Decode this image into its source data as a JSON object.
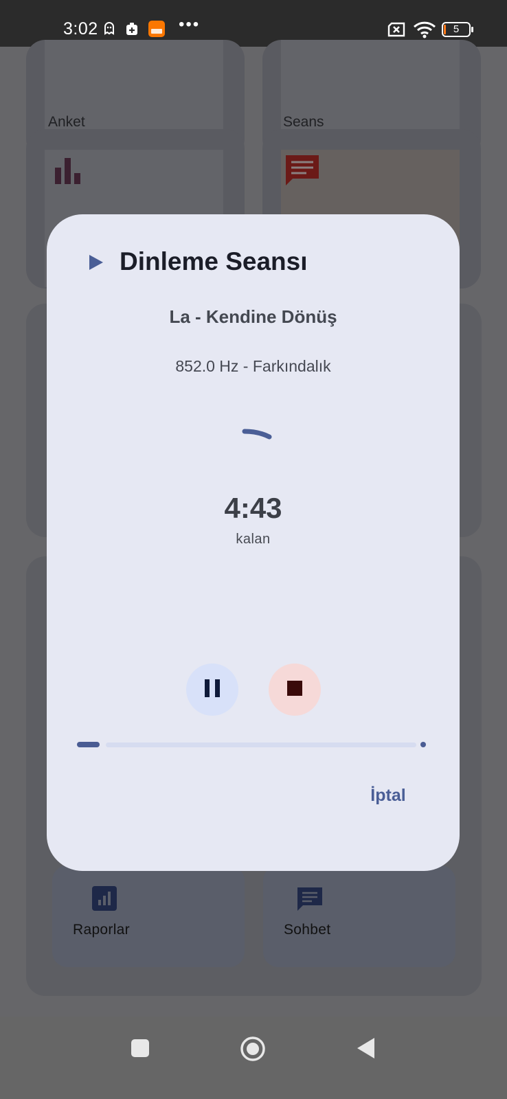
{
  "status_bar": {
    "time": "3:02",
    "battery_level": "5",
    "icons": [
      "ghost-icon",
      "medkit-icon",
      "temu-app-icon",
      "more-dots-icon",
      "no-sim-icon",
      "wifi-icon",
      "battery-icon"
    ]
  },
  "background": {
    "top_cards": [
      {
        "label": "Anket"
      },
      {
        "label": "Seans"
      }
    ],
    "tiles": [
      {
        "label": "Raporlar",
        "icon": "bar-chart-icon"
      },
      {
        "label": "Sohbet",
        "icon": "chat-icon"
      }
    ]
  },
  "dialog": {
    "title": "Dinleme Seansı",
    "title_icon": "play-icon",
    "track_name": "La - Kendine Dönüş",
    "frequency": "852.0 Hz - Farkındalık",
    "timer": "4:43",
    "remaining_label": "kalan",
    "progress": 0.06,
    "pause_icon": "pause-icon",
    "stop_icon": "stop-icon",
    "cancel_label": "İptal"
  },
  "colors": {
    "accent": "#4a5e96",
    "dialog_bg": "#e6e8f3",
    "pause_bg": "#d8e1f9",
    "stop_bg": "#f6d9d8"
  }
}
